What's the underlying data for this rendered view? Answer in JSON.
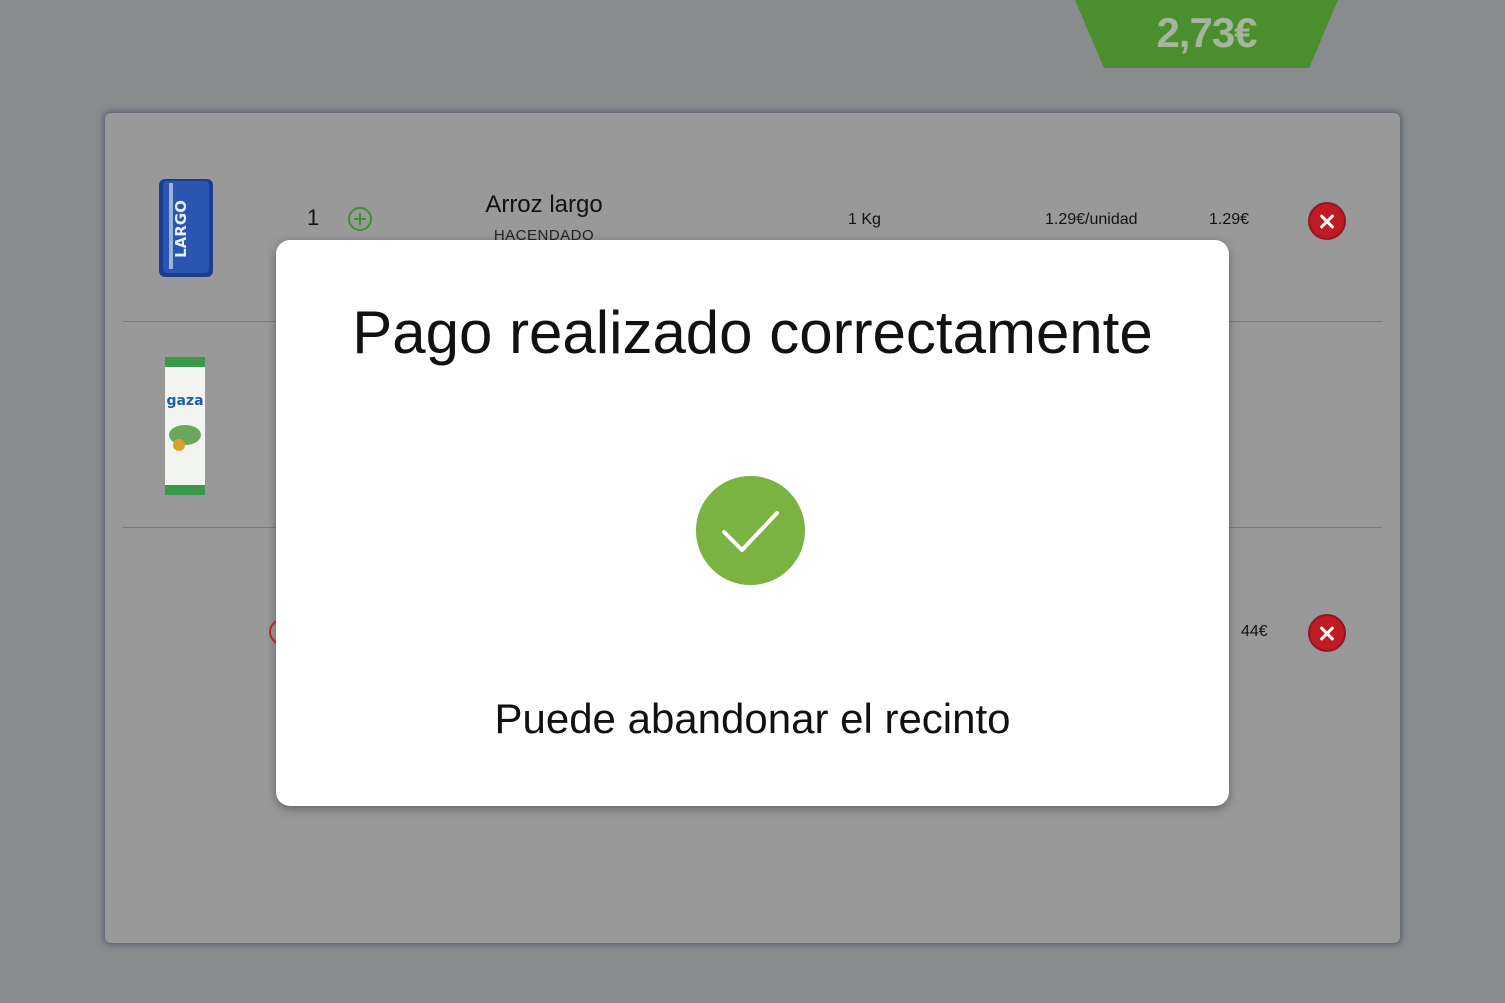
{
  "header": {
    "total": "2,73€"
  },
  "cart": {
    "items": [
      {
        "quantity": "1",
        "name": "Arroz largo",
        "brand": "HACENDADO",
        "weight": "1 Kg",
        "unit_price": "1.29€/unidad",
        "total": "1.29€",
        "package_text": "LARGO"
      },
      {
        "total_partial": "44€",
        "package_text": "gaza"
      }
    ]
  },
  "modal": {
    "title": "Pago realizado correctamente",
    "subtitle": "Puede abandonar el recinto"
  },
  "colors": {
    "accent_green": "#4b8e2d",
    "success": "#7bb342",
    "remove_red": "#c01a24"
  }
}
